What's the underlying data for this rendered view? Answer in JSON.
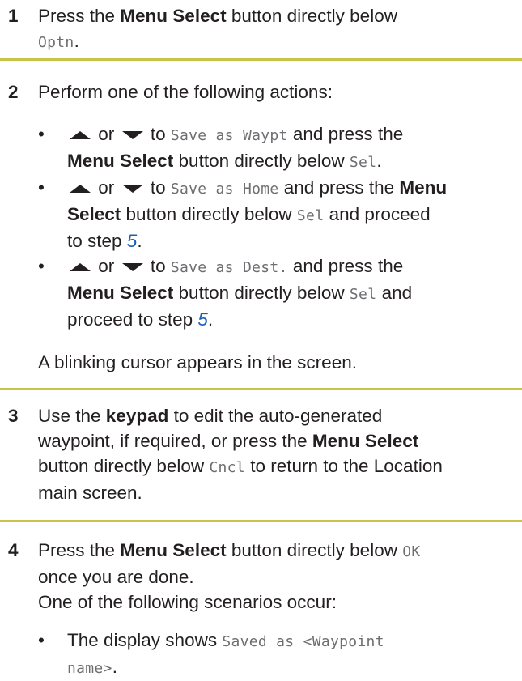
{
  "steps": [
    {
      "number": "1",
      "line1": {
        "a": "Press the ",
        "b": "Menu Select",
        "c": " button directly below"
      },
      "line2": {
        "m": "Optn",
        "d": "."
      }
    },
    {
      "number": "2",
      "intro": "Perform one of the following actions:",
      "bullets": [
        {
          "or": "or",
          "to": "to",
          "option": "Save as Waypt",
          "after": " and press the",
          "bold": "Menu Select",
          "text2": " button directly below ",
          "key": "Sel",
          "dot": "."
        },
        {
          "or": "or",
          "to": "to",
          "option": "Save as Home",
          "after": " and press the ",
          "bold1": "Menu",
          "bold2": "Select",
          "text2": " button directly below ",
          "key": "Sel",
          "text3": " and proceed",
          "text4": "to step ",
          "link": "5",
          "dot": "."
        },
        {
          "or": "or",
          "to": "to",
          "option": "Save as Dest.",
          "after": " and press the",
          "bold": "Menu Select",
          "text2": " button directly below ",
          "key": "Sel",
          "text3": " and",
          "text4": "proceed to step ",
          "link": "5",
          "dot": "."
        }
      ],
      "note": "A blinking cursor appears in the screen."
    },
    {
      "number": "3",
      "l1a": "Use the ",
      "l1b": "keypad",
      "l1c": " to edit the auto-generated",
      "l2a": "waypoint, if required, or press the ",
      "l2b": "Menu Select",
      "l3a": "button directly below ",
      "l3m": "Cncl",
      "l3b": " to return to the Location",
      "l4": "main screen."
    },
    {
      "number": "4",
      "l1a": "Press the ",
      "l1b": "Menu Select",
      "l1c": " button directly below ",
      "l1m": "OK",
      "l2": "once you are done.",
      "l3": "One of the following scenarios occur:",
      "bullet_a": "The display shows ",
      "bullet_m1": "Saved as <Waypoint",
      "bullet_m2": "name>",
      "bullet_dot": "."
    }
  ],
  "colors": {
    "rule": "#c8c44a",
    "link": "#1b5fb8",
    "mono": "#6d6e71"
  },
  "icons": [
    "up-arrow-icon",
    "down-arrow-icon"
  ]
}
